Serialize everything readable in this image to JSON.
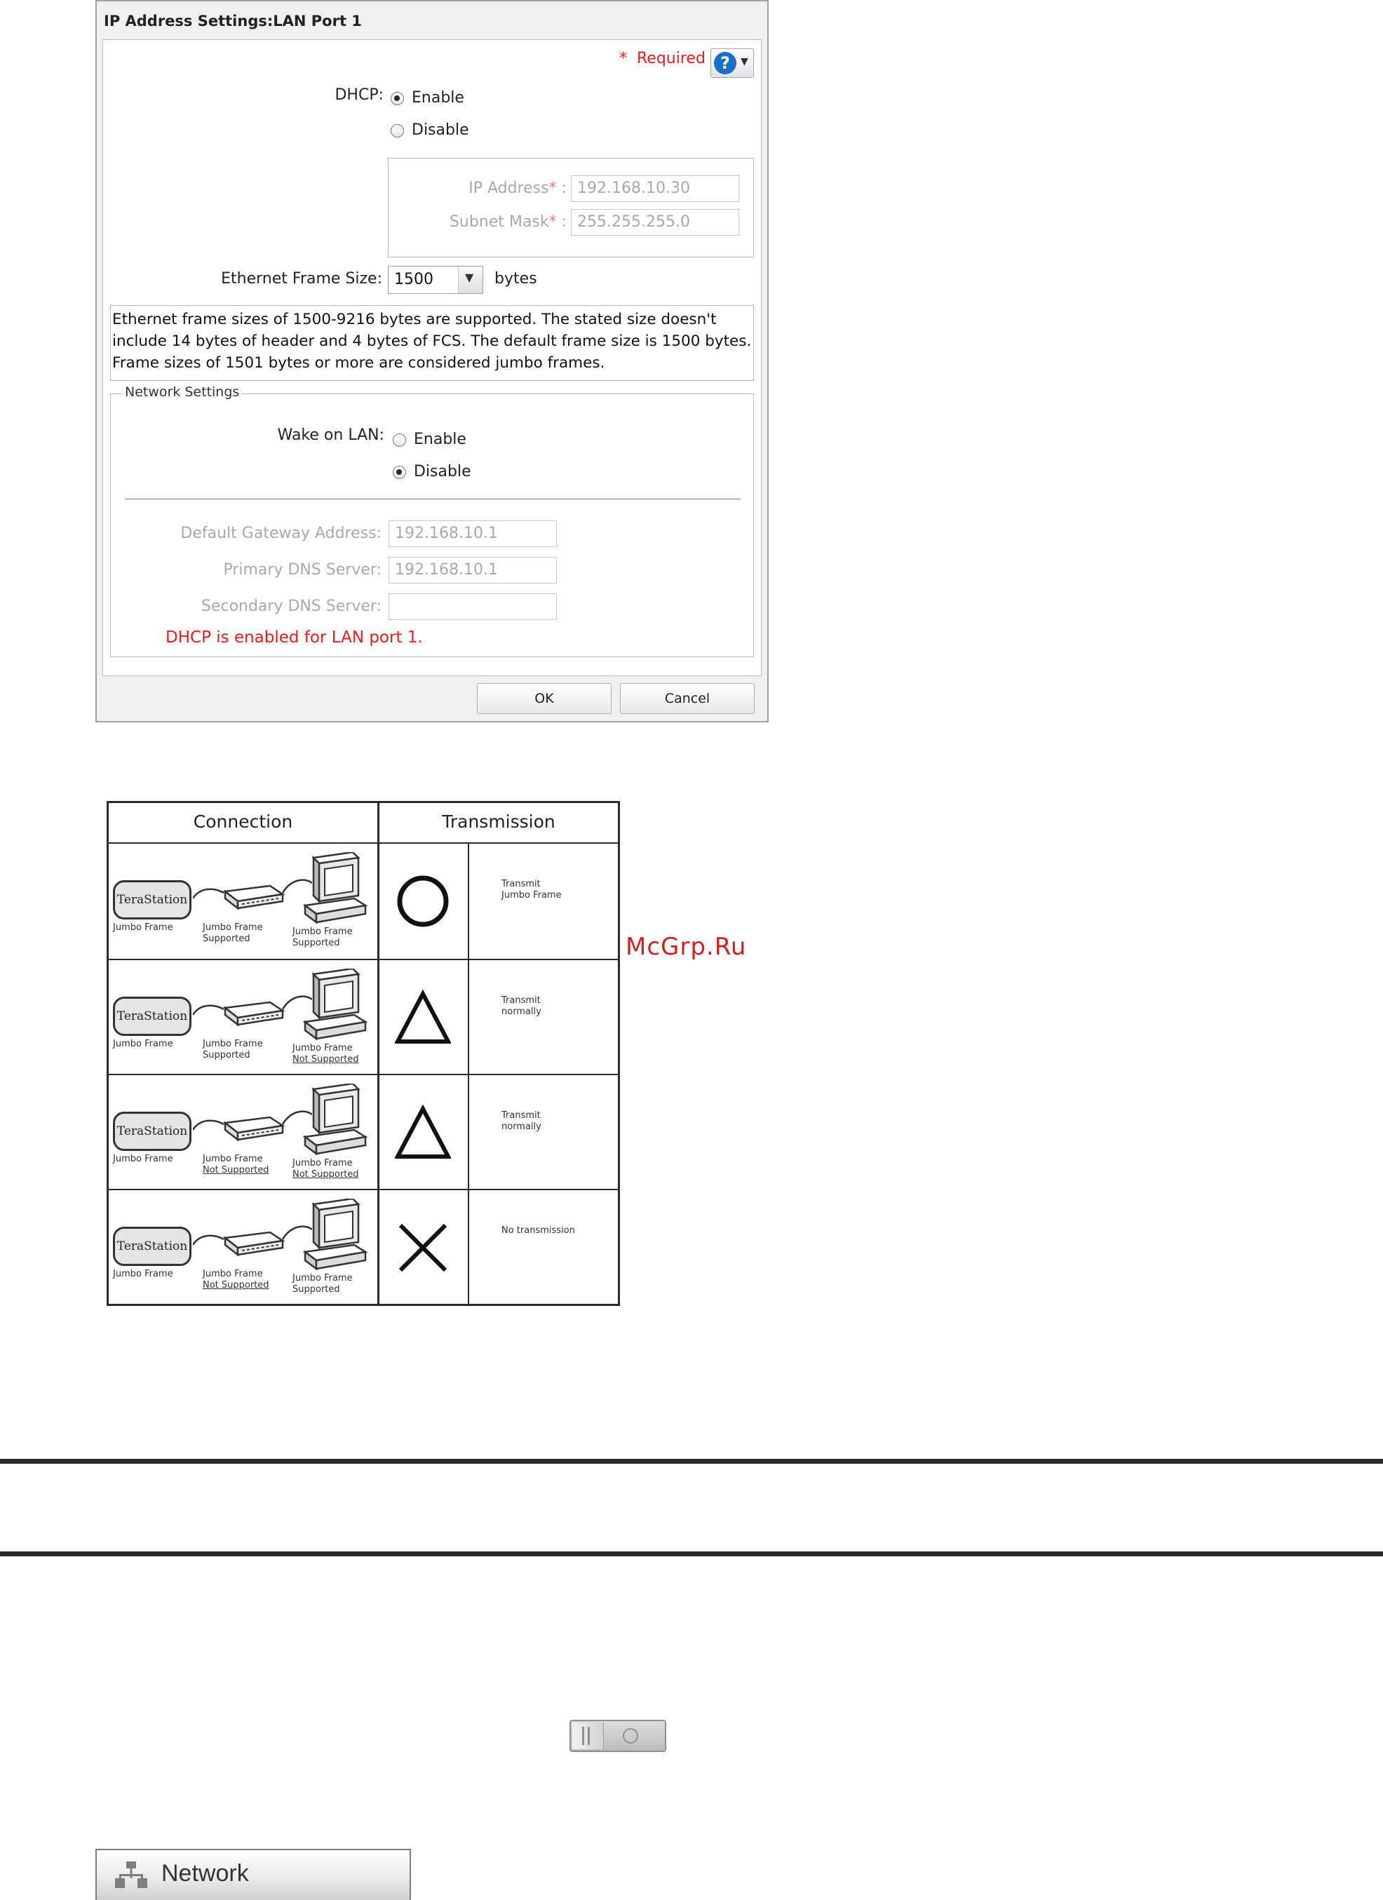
{
  "dialog": {
    "title": "IP Address Settings:LAN Port 1",
    "required_mark": "*",
    "required_label": "Required",
    "help_icon": "question-icon",
    "dhcp": {
      "label": "DHCP:",
      "options": [
        "Enable",
        "Disable"
      ],
      "selected": "Enable"
    },
    "ip_address": {
      "label": "IP Address",
      "value": "192.168.10.30"
    },
    "subnet_mask": {
      "label": "Subnet Mask",
      "value": "255.255.255.0"
    },
    "star": "*",
    "colon": ":",
    "frame_size": {
      "label": "Ethernet Frame Size:",
      "value": "1500",
      "unit": "bytes"
    },
    "info_lines": [
      "Ethernet frame sizes of 1500-9216 bytes are supported. The stated size doesn't",
      "include 14 bytes of header and 4 bytes of FCS. The default frame size is 1500 bytes.",
      "Frame sizes of 1501 bytes or more are considered jumbo frames."
    ],
    "network_settings": {
      "legend": "Network Settings",
      "wol": {
        "label": "Wake on LAN:",
        "options": [
          "Enable",
          "Disable"
        ],
        "selected": "Disable"
      },
      "gateway": {
        "label": "Default Gateway Address:",
        "value": "192.168.10.1"
      },
      "primary_dns": {
        "label": "Primary DNS Server:",
        "value": "192.168.10.1"
      },
      "secondary_dns": {
        "label": "Secondary DNS Server:",
        "value": ""
      },
      "note": "DHCP is enabled for LAN port 1."
    },
    "ok_label": "OK",
    "cancel_label": "Cancel"
  },
  "table": {
    "headers": [
      "Connection",
      "Transmission"
    ],
    "rows": [
      {
        "ts": "TeraStation",
        "ts_cap": "Jumbo Frame",
        "sw_l1": "Jumbo Frame",
        "sw_l2": "Supported",
        "sw_u": false,
        "pc_l1": "Jumbo Frame",
        "pc_l2": "Supported",
        "pc_u": false,
        "symbol": "circle",
        "desc_l1": "Transmit",
        "desc_l2": "Jumbo Frame"
      },
      {
        "ts": "TeraStation",
        "ts_cap": "Jumbo Frame",
        "sw_l1": "Jumbo Frame",
        "sw_l2": "Supported",
        "sw_u": false,
        "pc_l1": "Jumbo Frame",
        "pc_l2": "Not Supported",
        "pc_u": true,
        "symbol": "triangle",
        "desc_l1": "Transmit",
        "desc_l2": "normally"
      },
      {
        "ts": "TeraStation",
        "ts_cap": "Jumbo Frame",
        "sw_l1": "Jumbo Frame",
        "sw_l2": "Not Supported",
        "sw_u": true,
        "pc_l1": "Jumbo Frame",
        "pc_l2": "Not Supported",
        "pc_u": true,
        "symbol": "triangle",
        "desc_l1": "Transmit",
        "desc_l2": "normally"
      },
      {
        "ts": "TeraStation",
        "ts_cap": "Jumbo Frame",
        "sw_l1": "Jumbo Frame",
        "sw_l2": "Not Supported",
        "sw_u": true,
        "pc_l1": "Jumbo Frame",
        "pc_l2": "Supported",
        "pc_u": false,
        "symbol": "cross",
        "desc_l1": "No transmission",
        "desc_l2": ""
      }
    ]
  },
  "watermark": "McGrp.Ru",
  "toggle_icon": "toggle-switch-icon",
  "network_tab": {
    "label": "Network",
    "icon": "network-icon"
  }
}
